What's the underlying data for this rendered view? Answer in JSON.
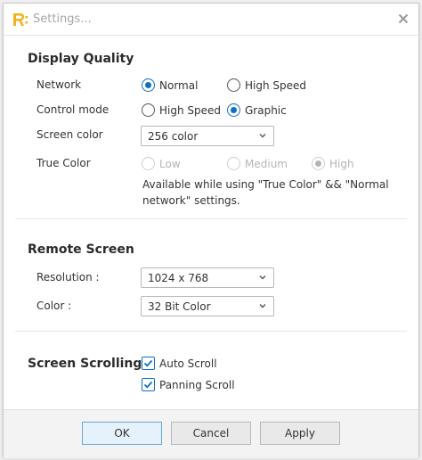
{
  "window": {
    "title": "Settings...",
    "logo_icon": "app-logo-icon",
    "close_icon": "close-icon",
    "accent": "#0f6fc6",
    "logo_color": "#f2b01e"
  },
  "display_quality": {
    "title": "Display Quality",
    "network": {
      "label": "Network",
      "options": [
        "Normal",
        "High Speed"
      ],
      "selected": "Normal"
    },
    "control_mode": {
      "label": "Control mode",
      "options": [
        "High Speed",
        "Graphic"
      ],
      "selected": "Graphic"
    },
    "screen_color": {
      "label": "Screen color",
      "value": "256 color"
    },
    "true_color": {
      "label": "True Color",
      "options": [
        "Low",
        "Medium",
        "High"
      ],
      "selected": "High",
      "disabled": true
    },
    "note": "Available while using \"True Color\" && \"Normal network\" settings."
  },
  "remote_screen": {
    "title": "Remote Screen",
    "resolution": {
      "label": "Resolution :",
      "value": "1024 x 768"
    },
    "color": {
      "label": "Color :",
      "value": "32 Bit Color"
    }
  },
  "screen_scrolling": {
    "title": "Screen Scrolling",
    "auto_scroll": {
      "label": "Auto Scroll",
      "checked": true
    },
    "panning_scroll": {
      "label": "Panning Scroll",
      "checked": true
    }
  },
  "footer": {
    "ok": "OK",
    "cancel": "Cancel",
    "apply": "Apply"
  }
}
